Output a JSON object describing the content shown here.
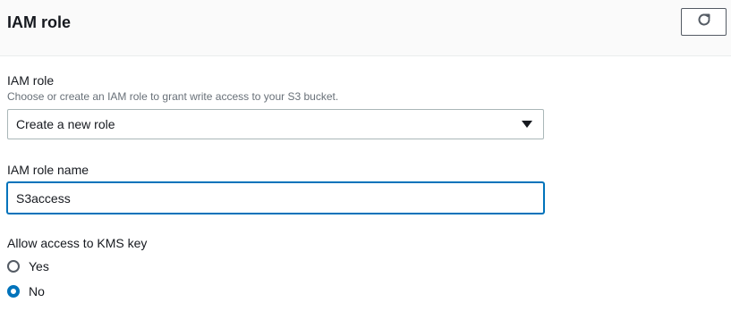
{
  "header": {
    "title": "IAM role",
    "refresh_icon": "refresh-icon"
  },
  "iam_role": {
    "label": "IAM role",
    "description": "Choose or create an IAM role to grant write access to your S3 bucket.",
    "selected": "Create a new role",
    "caret_icon": "caret-down-icon"
  },
  "role_name": {
    "label": "IAM role name",
    "value": "S3access"
  },
  "kms": {
    "label": "Allow access to KMS key",
    "options": [
      {
        "label": "Yes",
        "checked": false
      },
      {
        "label": "No",
        "checked": true
      }
    ]
  },
  "colors": {
    "accent": "#0073bb",
    "text": "#16191f",
    "muted": "#687078",
    "border": "#aab7b8"
  }
}
